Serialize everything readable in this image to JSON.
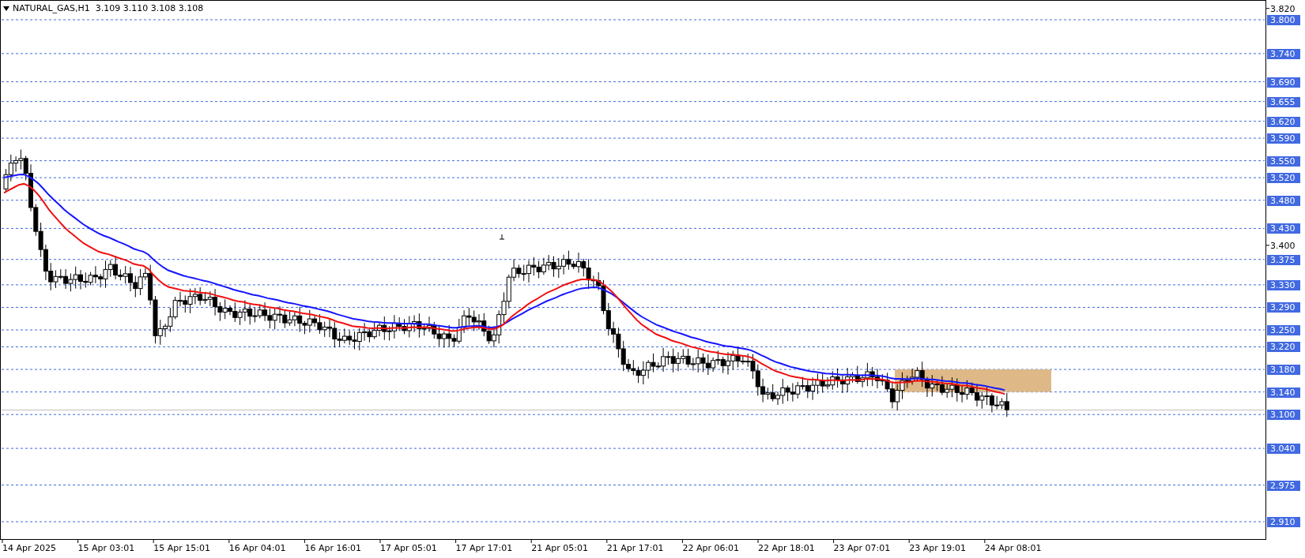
{
  "chart": {
    "title": "NATURAL_GAS,H1  3.109 3.110 3.108 3.108"
  },
  "levels": [
    {
      "label": "3.800"
    },
    {
      "label": "3.740"
    },
    {
      "label": "3.690"
    },
    {
      "label": "3.655"
    },
    {
      "label": "3.620"
    },
    {
      "label": "3.590"
    },
    {
      "label": "3.550"
    },
    {
      "label": "3.520"
    },
    {
      "label": "3.480"
    },
    {
      "label": "3.430"
    },
    {
      "label": "3.375"
    },
    {
      "label": "3.330"
    },
    {
      "label": "3.290"
    },
    {
      "label": "3.250"
    },
    {
      "label": "3.220"
    },
    {
      "label": "3.180"
    },
    {
      "label": "3.140"
    },
    {
      "label": "3.100"
    },
    {
      "label": "3.040"
    },
    {
      "label": "2.975"
    },
    {
      "label": "2.910"
    }
  ],
  "price_scale": [
    "3.820",
    "3.400"
  ],
  "time_axis": [
    "14 Apr 2025",
    "15 Apr 03:01",
    "15 Apr 15:01",
    "16 Apr 04:01",
    "16 Apr 16:01",
    "17 Apr 05:01",
    "17 Apr 17:01",
    "21 Apr 05:01",
    "21 Apr 17:01",
    "22 Apr 06:01",
    "22 Apr 18:01",
    "23 Apr 07:01",
    "23 Apr 19:01",
    "24 Apr 08:01"
  ]
}
